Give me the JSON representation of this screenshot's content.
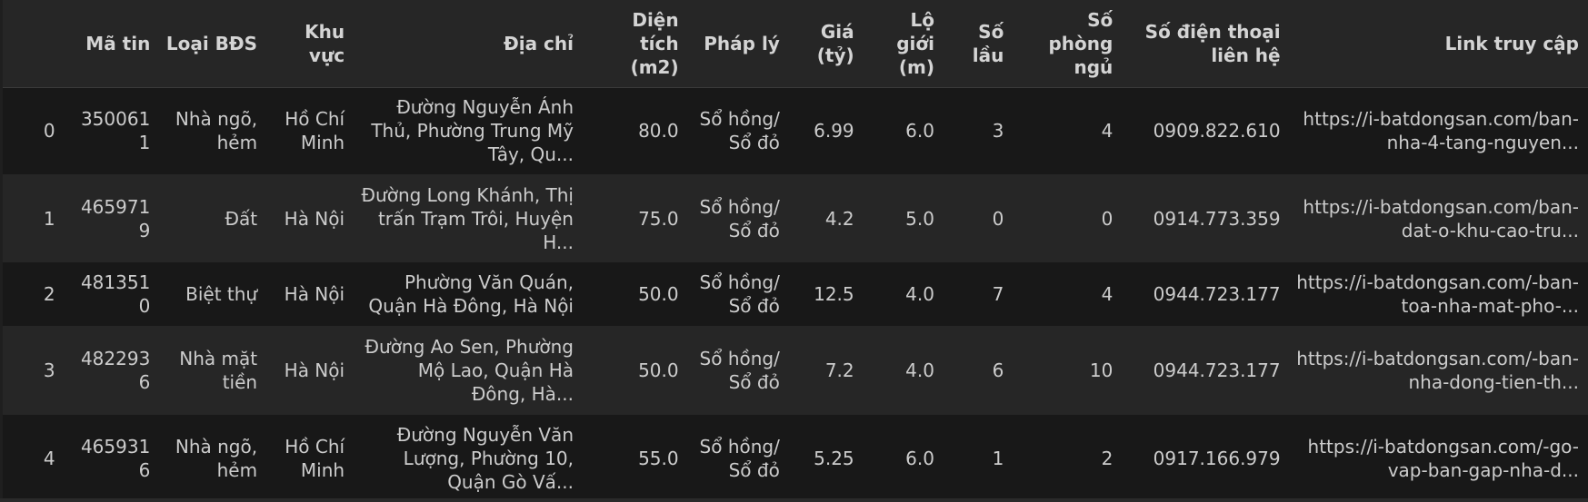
{
  "table": {
    "columns": [
      "",
      "Mã tin",
      "Loại BĐS",
      "Khu vực",
      "Địa chỉ",
      "Diện tích (m2)",
      "Pháp lý",
      "Giá (tỷ)",
      "Lộ giới (m)",
      "Số lầu",
      "Số phòng ngủ",
      "Số điện thoại liên hệ",
      "Link truy cập"
    ],
    "rows": [
      [
        "0",
        "3500611",
        "Nhà ngõ, hẻm",
        "Hồ Chí Minh",
        "Đường Nguyễn Ánh Thủ, Phường Trung Mỹ Tây, Qu...",
        "80.0",
        "Sổ hồng/ Sổ đỏ",
        "6.99",
        "6.0",
        "3",
        "4",
        "0909.822.610",
        "https://i-batdongsan.com/ban-nha-4-tang-nguyen..."
      ],
      [
        "1",
        "4659719",
        "Đất",
        "Hà Nội",
        "Đường Long Khánh, Thị trấn Trạm Trôi, Huyện H...",
        "75.0",
        "Sổ hồng/ Sổ đỏ",
        "4.2",
        "5.0",
        "0",
        "0",
        "0914.773.359",
        "https://i-batdongsan.com/ban-dat-o-khu-cao-tru..."
      ],
      [
        "2",
        "4813510",
        "Biệt thự",
        "Hà Nội",
        "Phường Văn Quán, Quận Hà Đông, Hà Nội",
        "50.0",
        "Sổ hồng/ Sổ đỏ",
        "12.5",
        "4.0",
        "7",
        "4",
        "0944.723.177",
        "https://i-batdongsan.com/-ban-toa-nha-mat-pho-..."
      ],
      [
        "3",
        "4822936",
        "Nhà mặt tiền",
        "Hà Nội",
        "Đường Ao Sen, Phường Mộ Lao, Quận Hà Đông, Hà...",
        "50.0",
        "Sổ hồng/ Sổ đỏ",
        "7.2",
        "4.0",
        "6",
        "10",
        "0944.723.177",
        "https://i-batdongsan.com/-ban-nha-dong-tien-th..."
      ],
      [
        "4",
        "4659316",
        "Nhà ngõ, hẻm",
        "Hồ Chí Minh",
        "Đường Nguyễn Văn Lượng, Phường 10, Quận Gò Vấ...",
        "55.0",
        "Sổ hồng/ Sổ đỏ",
        "5.25",
        "6.0",
        "1",
        "2",
        "0917.166.979",
        "https://i-batdongsan.com/-go-vap-ban-gap-nha-d..."
      ]
    ]
  }
}
